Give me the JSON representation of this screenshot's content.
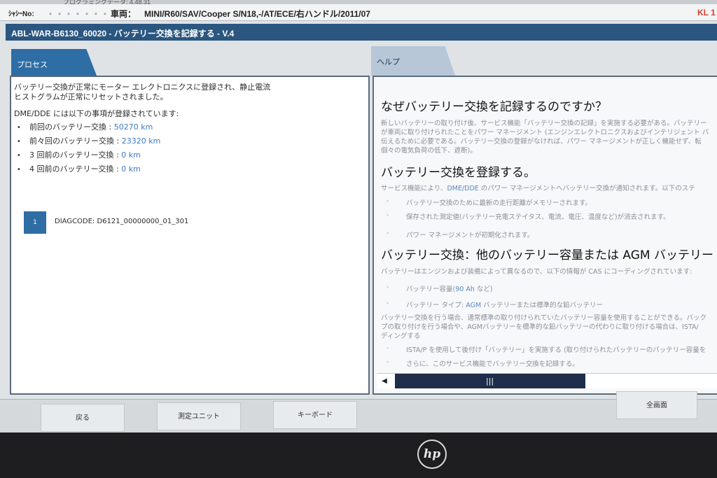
{
  "topstrip": {
    "text": "プログラミングデータ: 4.48.31"
  },
  "infobar": {
    "chassis_label": "ｼｬｼｰNo:",
    "chassis_value": "・・・・・・・",
    "vehicle_label": "車両：",
    "vehicle_value": "MINI/R60/SAV/Cooper S/N18,-/AT/ECE/右ハンドル/2011/07",
    "kl_status": "KL 1"
  },
  "title": "ABL-WAR-B6130_60020 - バッテリー交換を記録する - V.4",
  "tabs": {
    "process": "プロセス",
    "help": "ヘルプ"
  },
  "process": {
    "message_line1": "バッテリー交換が正常にモーター エレクトロニクスに登録され、静止電流",
    "message_line2": "ヒストグラムが正常にリセットされました。",
    "intro": "DME/DDE には以下の事項が登録されています:",
    "history": [
      {
        "label": "前回のバッテリー交換 : ",
        "value": "50270 km"
      },
      {
        "label": "前々回のバッテリー交換 : ",
        "value": "23320 km"
      },
      {
        "label": "3 回前のバッテリー交換 : ",
        "value": "0 km"
      },
      {
        "label": "4 回前のバッテリー交換 : ",
        "value": "0 km"
      }
    ],
    "bullet": "•",
    "diag_number": "1",
    "diag_code": "DIAGCODE: D6121_00000000_01_301"
  },
  "help": {
    "heading1": "なぜバッテリー交換を記録するのですか？",
    "p1_line1": "新しいバッテリーの取り付け後、サービス機能「バッテリー交換の記録」を実施する必要がある。バッテリー",
    "p1_line2": "が車両に取り付けられたことをパワー マネージメント (エンジンエレクトロニクスおよびインテリジェント バ",
    "p1_line3": "伝えるために必要である。バッテリー交換の登録がなければ、パワー マネージメントが正しく機能せず、転",
    "p1_line4": "個々の電気負荷の低下、遮断)。",
    "heading2": "バッテリー交換を登録する。",
    "p2_prefix": "サービス機能により、",
    "p2_link": "DME/DDE",
    "p2_suffix": " のパワー マネージメントへバッテリー交換が通知されます。以下のステ",
    "list2": [
      "バッテリー交換のために最新の走行距離がメモリーされます。",
      "保存された測定値(バッテリー充電ステイタス、電流、電圧、温度など)が消去されます。",
      "パワー マネージメントが初期化されます。"
    ],
    "heading3": "バッテリー交換：他のバッテリー容量または AGM バッテリー",
    "p3": "バッテリーはエンジンおよび装備によって異なるので、以下の情報が CAS にコーディングされています:",
    "list3_item1_prefix": "バッテリー容量(",
    "list3_item1_link": "90 Ah",
    "list3_item1_suffix": " など)",
    "list3_item2_prefix": "バッテリー タイプ: ",
    "list3_item2_link": "AGM",
    "list3_item2_suffix": " バッテリーまたは標準的な鉛バッテリー",
    "p4_line1": "バッテリー交換を行う場合、通常標準の取り付けられていたバッテリー容量を使用することができる。バック",
    "p4_line2": "プの取り付けを行う場合や、AGMバッテリーを標準的な鉛バッテリーの代わりに取り付ける場合は、ISTA/",
    "p4_line3": "ディングする",
    "list4": [
      "ISTA/P を使用して後付け「バッテリー」を実施する (取り付けられたバッテリーのバッテリー容量を",
      "さらに、このサービス機能でバッテリー交換を記録する。"
    ],
    "dash": "-"
  },
  "scrollbar": {
    "left_arrow": "◀",
    "grip": "|||"
  },
  "buttons": {
    "back": "戻る",
    "measure": "測定ユニット",
    "keyboard": "キーボード",
    "fullscreen": "全画面"
  },
  "bezel": {
    "logo": "hp"
  }
}
